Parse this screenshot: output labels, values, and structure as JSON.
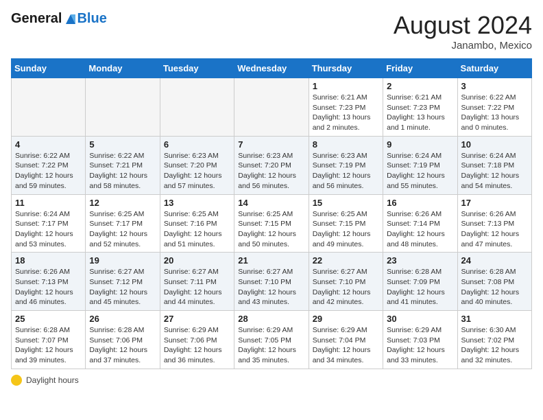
{
  "header": {
    "logo_line1": "General",
    "logo_line2": "Blue",
    "month": "August 2024",
    "location": "Janambo, Mexico"
  },
  "weekdays": [
    "Sunday",
    "Monday",
    "Tuesday",
    "Wednesday",
    "Thursday",
    "Friday",
    "Saturday"
  ],
  "weeks": [
    [
      {
        "day": "",
        "info": ""
      },
      {
        "day": "",
        "info": ""
      },
      {
        "day": "",
        "info": ""
      },
      {
        "day": "",
        "info": ""
      },
      {
        "day": "1",
        "info": "Sunrise: 6:21 AM\nSunset: 7:23 PM\nDaylight: 13 hours\nand 2 minutes."
      },
      {
        "day": "2",
        "info": "Sunrise: 6:21 AM\nSunset: 7:23 PM\nDaylight: 13 hours\nand 1 minute."
      },
      {
        "day": "3",
        "info": "Sunrise: 6:22 AM\nSunset: 7:22 PM\nDaylight: 13 hours\nand 0 minutes."
      }
    ],
    [
      {
        "day": "4",
        "info": "Sunrise: 6:22 AM\nSunset: 7:22 PM\nDaylight: 12 hours\nand 59 minutes."
      },
      {
        "day": "5",
        "info": "Sunrise: 6:22 AM\nSunset: 7:21 PM\nDaylight: 12 hours\nand 58 minutes."
      },
      {
        "day": "6",
        "info": "Sunrise: 6:23 AM\nSunset: 7:20 PM\nDaylight: 12 hours\nand 57 minutes."
      },
      {
        "day": "7",
        "info": "Sunrise: 6:23 AM\nSunset: 7:20 PM\nDaylight: 12 hours\nand 56 minutes."
      },
      {
        "day": "8",
        "info": "Sunrise: 6:23 AM\nSunset: 7:19 PM\nDaylight: 12 hours\nand 56 minutes."
      },
      {
        "day": "9",
        "info": "Sunrise: 6:24 AM\nSunset: 7:19 PM\nDaylight: 12 hours\nand 55 minutes."
      },
      {
        "day": "10",
        "info": "Sunrise: 6:24 AM\nSunset: 7:18 PM\nDaylight: 12 hours\nand 54 minutes."
      }
    ],
    [
      {
        "day": "11",
        "info": "Sunrise: 6:24 AM\nSunset: 7:17 PM\nDaylight: 12 hours\nand 53 minutes."
      },
      {
        "day": "12",
        "info": "Sunrise: 6:25 AM\nSunset: 7:17 PM\nDaylight: 12 hours\nand 52 minutes."
      },
      {
        "day": "13",
        "info": "Sunrise: 6:25 AM\nSunset: 7:16 PM\nDaylight: 12 hours\nand 51 minutes."
      },
      {
        "day": "14",
        "info": "Sunrise: 6:25 AM\nSunset: 7:15 PM\nDaylight: 12 hours\nand 50 minutes."
      },
      {
        "day": "15",
        "info": "Sunrise: 6:25 AM\nSunset: 7:15 PM\nDaylight: 12 hours\nand 49 minutes."
      },
      {
        "day": "16",
        "info": "Sunrise: 6:26 AM\nSunset: 7:14 PM\nDaylight: 12 hours\nand 48 minutes."
      },
      {
        "day": "17",
        "info": "Sunrise: 6:26 AM\nSunset: 7:13 PM\nDaylight: 12 hours\nand 47 minutes."
      }
    ],
    [
      {
        "day": "18",
        "info": "Sunrise: 6:26 AM\nSunset: 7:13 PM\nDaylight: 12 hours\nand 46 minutes."
      },
      {
        "day": "19",
        "info": "Sunrise: 6:27 AM\nSunset: 7:12 PM\nDaylight: 12 hours\nand 45 minutes."
      },
      {
        "day": "20",
        "info": "Sunrise: 6:27 AM\nSunset: 7:11 PM\nDaylight: 12 hours\nand 44 minutes."
      },
      {
        "day": "21",
        "info": "Sunrise: 6:27 AM\nSunset: 7:10 PM\nDaylight: 12 hours\nand 43 minutes."
      },
      {
        "day": "22",
        "info": "Sunrise: 6:27 AM\nSunset: 7:10 PM\nDaylight: 12 hours\nand 42 minutes."
      },
      {
        "day": "23",
        "info": "Sunrise: 6:28 AM\nSunset: 7:09 PM\nDaylight: 12 hours\nand 41 minutes."
      },
      {
        "day": "24",
        "info": "Sunrise: 6:28 AM\nSunset: 7:08 PM\nDaylight: 12 hours\nand 40 minutes."
      }
    ],
    [
      {
        "day": "25",
        "info": "Sunrise: 6:28 AM\nSunset: 7:07 PM\nDaylight: 12 hours\nand 39 minutes."
      },
      {
        "day": "26",
        "info": "Sunrise: 6:28 AM\nSunset: 7:06 PM\nDaylight: 12 hours\nand 37 minutes."
      },
      {
        "day": "27",
        "info": "Sunrise: 6:29 AM\nSunset: 7:06 PM\nDaylight: 12 hours\nand 36 minutes."
      },
      {
        "day": "28",
        "info": "Sunrise: 6:29 AM\nSunset: 7:05 PM\nDaylight: 12 hours\nand 35 minutes."
      },
      {
        "day": "29",
        "info": "Sunrise: 6:29 AM\nSunset: 7:04 PM\nDaylight: 12 hours\nand 34 minutes."
      },
      {
        "day": "30",
        "info": "Sunrise: 6:29 AM\nSunset: 7:03 PM\nDaylight: 12 hours\nand 33 minutes."
      },
      {
        "day": "31",
        "info": "Sunrise: 6:30 AM\nSunset: 7:02 PM\nDaylight: 12 hours\nand 32 minutes."
      }
    ]
  ],
  "footer": {
    "daylight_label": "Daylight hours"
  }
}
